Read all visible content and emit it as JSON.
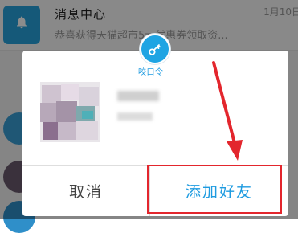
{
  "list": {
    "message_center": {
      "title": "消息中心",
      "subtitle": "恭喜获得天猫超市5元优惠券领取资...",
      "time": "1月10日"
    }
  },
  "dialog": {
    "badge_label": "咬口令",
    "cancel_label": "取消",
    "add_friend_label": "添加好友"
  },
  "colors": {
    "accent_blue": "#1e9be0",
    "annotation_red": "#e3262d",
    "bell_tile": "#27a3dd"
  },
  "icons": {
    "message_center": "bell-icon",
    "badge": "key-icon"
  }
}
